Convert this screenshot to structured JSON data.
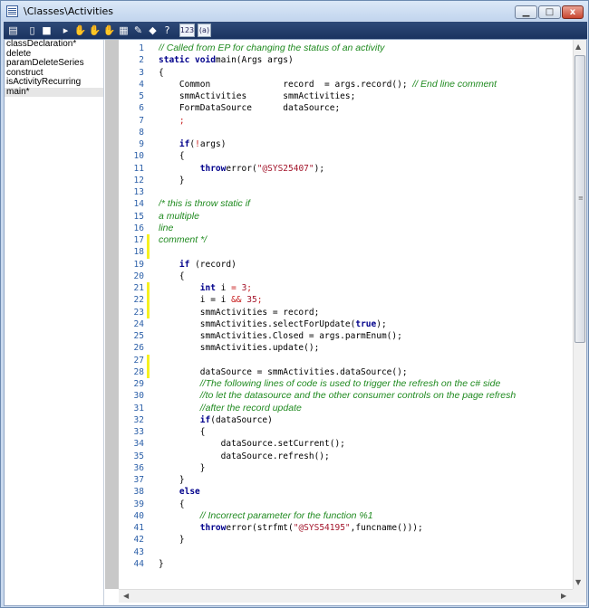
{
  "window": {
    "title": "\\Classes\\Activities",
    "min": "▁",
    "max": "□",
    "close": "x"
  },
  "toolbar": {
    "icons": [
      {
        "name": "properties-icon",
        "glyph": "▤"
      },
      {
        "name": "new-icon",
        "glyph": "▯"
      },
      {
        "name": "save-icon",
        "glyph": "■"
      },
      {
        "name": "run-icon",
        "glyph": "▸"
      },
      {
        "name": "breakpoint-icon",
        "glyph": "✋"
      },
      {
        "name": "remove-breakpoints-icon",
        "glyph": "✋"
      },
      {
        "name": "enable-breakpoint-icon",
        "glyph": "✋"
      },
      {
        "name": "compile-icon",
        "glyph": "▦"
      },
      {
        "name": "lookup-icon",
        "glyph": "✎"
      },
      {
        "name": "source-control-icon",
        "glyph": "◆"
      },
      {
        "name": "help-icon",
        "glyph": "?"
      }
    ],
    "line_numbers_label": "123",
    "script_label": "(a)"
  },
  "methods": [
    "classDeclaration*",
    "delete",
    "paramDeleteSeries",
    "construct",
    "isActivityRecurring",
    "main*"
  ],
  "selected_method": "main*",
  "highlighted_lines": [
    17,
    18,
    21,
    22,
    23,
    27,
    28
  ],
  "code": [
    [
      [
        "cm",
        "// Called from EP for changing the status of an activity"
      ]
    ],
    [
      [
        "kw",
        "static void"
      ],
      [
        "",
        "main(Args args)"
      ]
    ],
    [
      [
        "",
        "{"
      ]
    ],
    [
      [
        "",
        "    Common              record  = args.record(); "
      ],
      [
        "cm",
        "// End line comment"
      ]
    ],
    [
      [
        "",
        "    smmActivities       smmActivities;"
      ]
    ],
    [
      [
        "",
        "    FormDataSource      dataSource;"
      ]
    ],
    [
      [
        "op",
        "    ;"
      ]
    ],
    [
      [
        "",
        ""
      ]
    ],
    [
      [
        "",
        "    "
      ],
      [
        "kw",
        "if"
      ],
      [
        "",
        "("
      ],
      [
        "op",
        "!"
      ],
      [
        "",
        "args)"
      ]
    ],
    [
      [
        "",
        "    {"
      ]
    ],
    [
      [
        "",
        "        "
      ],
      [
        "kw",
        "throw"
      ],
      [
        "",
        "error("
      ],
      [
        "st",
        "\"@SYS25407\""
      ],
      [
        "",
        ");"
      ]
    ],
    [
      [
        "",
        "    }"
      ]
    ],
    [
      [
        "",
        ""
      ]
    ],
    [
      [
        "cm",
        "/* this is throw static if"
      ]
    ],
    [
      [
        "cm",
        "a multiple"
      ]
    ],
    [
      [
        "cm",
        "line"
      ]
    ],
    [
      [
        "cm",
        "comment */"
      ]
    ],
    [
      [
        "",
        ""
      ]
    ],
    [
      [
        "",
        "    "
      ],
      [
        "kw",
        "if"
      ],
      [
        "",
        " (record)"
      ]
    ],
    [
      [
        "",
        "    {"
      ]
    ],
    [
      [
        "",
        "        "
      ],
      [
        "kw",
        "int"
      ],
      [
        "",
        " i "
      ],
      [
        "op",
        "="
      ],
      [
        "st",
        " 3"
      ],
      [
        "op",
        ";"
      ]
    ],
    [
      [
        "",
        "        i = i "
      ],
      [
        "op",
        "&&"
      ],
      [
        "st",
        " 35"
      ],
      [
        "op",
        ";"
      ]
    ],
    [
      [
        "",
        "        smmActivities = record;"
      ]
    ],
    [
      [
        "",
        "        smmActivities.selectForUpdate("
      ],
      [
        "kw",
        "true"
      ],
      [
        "",
        ");"
      ]
    ],
    [
      [
        "",
        "        smmActivities.Closed = args.parmEnum();"
      ]
    ],
    [
      [
        "",
        "        smmActivities.update();"
      ]
    ],
    [
      [
        "",
        ""
      ]
    ],
    [
      [
        "",
        "        dataSource = smmActivities.dataSource();"
      ]
    ],
    [
      [
        "",
        "        "
      ],
      [
        "cm",
        "//The following lines of code is used to trigger the refresh on the c# side"
      ]
    ],
    [
      [
        "",
        "        "
      ],
      [
        "cm",
        "//to let the datasource and the other consumer controls on the page refresh"
      ]
    ],
    [
      [
        "",
        "        "
      ],
      [
        "cm",
        "//after the record update"
      ]
    ],
    [
      [
        "",
        "        "
      ],
      [
        "kw",
        "if"
      ],
      [
        "",
        "(dataSource)"
      ]
    ],
    [
      [
        "",
        "        {"
      ]
    ],
    [
      [
        "",
        "            dataSource.setCurrent();"
      ]
    ],
    [
      [
        "",
        "            dataSource.refresh();"
      ]
    ],
    [
      [
        "",
        "        }"
      ]
    ],
    [
      [
        "",
        "    }"
      ]
    ],
    [
      [
        "",
        "    "
      ],
      [
        "kw",
        "else"
      ]
    ],
    [
      [
        "",
        "    {"
      ]
    ],
    [
      [
        "",
        "        "
      ],
      [
        "cm",
        "// Incorrect parameter for the function %1"
      ]
    ],
    [
      [
        "",
        "        "
      ],
      [
        "kw",
        "throw"
      ],
      [
        "",
        "error(strfmt("
      ],
      [
        "st",
        "\"@SYS54195\""
      ],
      [
        "",
        ",funcname()));"
      ]
    ],
    [
      [
        "",
        "    }"
      ]
    ],
    [
      [
        "",
        ""
      ]
    ],
    [
      [
        "",
        "}"
      ]
    ]
  ]
}
